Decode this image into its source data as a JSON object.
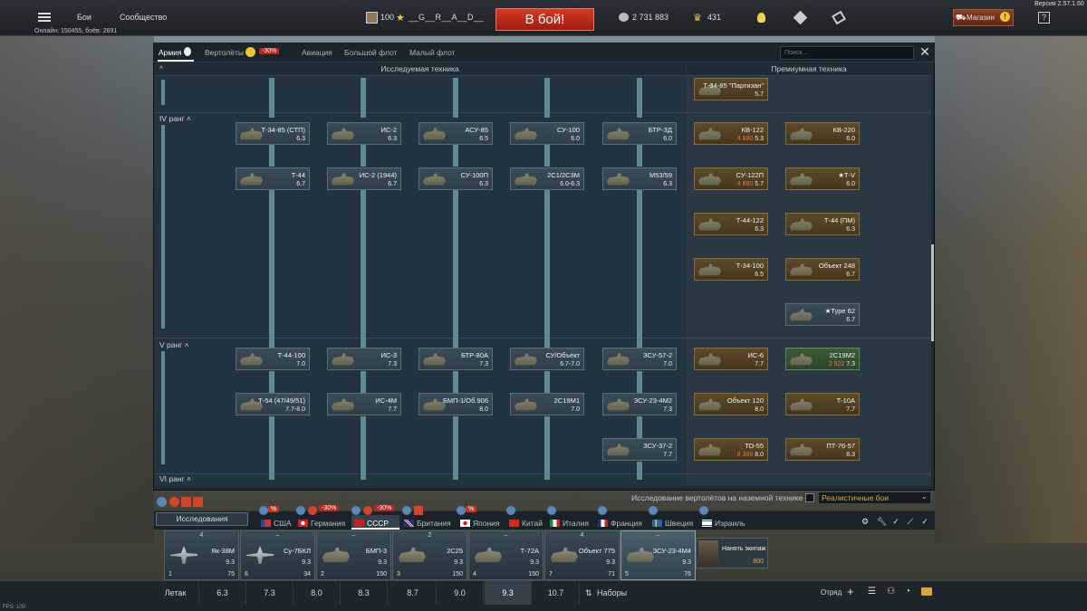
{
  "version": "Версия 2.57.1.60",
  "online": "Онлайн: 150455, боёв: 2691",
  "topnav": {
    "battles": "Бои",
    "community": "Сообщество"
  },
  "player": {
    "level": "100",
    "name": "__G__R__A__D__"
  },
  "battle_button": "В бой!",
  "currency": {
    "silver": "2 731 883",
    "gold": "431"
  },
  "shop": "Магазин",
  "help": "?",
  "tabs": [
    {
      "label": "Армия",
      "active": true
    },
    {
      "label": "Вертолёты"
    },
    {
      "label": "Авиация"
    },
    {
      "label": "Большой флот"
    },
    {
      "label": "Малый флот"
    }
  ],
  "heli_discount": "-30%",
  "search_placeholder": "Поиск...",
  "headers": {
    "researched": "Исследуемая техника",
    "premium": "Премиумная техника"
  },
  "ranks": {
    "r4": "IV ранг ˄",
    "r5": "V ранг ˄",
    "r6": "VI ранг ˄"
  },
  "vehicles": {
    "c1": {
      "name": "Т-34-85 (СТП)",
      "br": "6.3"
    },
    "c2": {
      "name": "Т-44",
      "br": "6.7"
    },
    "c3": {
      "name": "ИС-2",
      "br": "6.3"
    },
    "c4": {
      "name": "ИС-2 (1944)",
      "br": "6.7"
    },
    "c5": {
      "name": "АСУ-85",
      "br": "6.5"
    },
    "c6": {
      "name": "СУ-100П",
      "br": "6.3"
    },
    "c7": {
      "name": "СУ-100",
      "br": "6.0"
    },
    "c8": {
      "name": "2С1/2С3М",
      "br": "6.0-6.3"
    },
    "c9": {
      "name": "БТР-ЗД",
      "br": "6.0"
    },
    "c10": {
      "name": "М53/59",
      "br": "6.3"
    },
    "c11": {
      "name": "Т-44-100",
      "br": "7.0"
    },
    "c12": {
      "name": "Т-54 (47/49/51)",
      "br": "7.7-8.0"
    },
    "c13": {
      "name": "ИС-3",
      "br": "7.3"
    },
    "c14": {
      "name": "ИС-4М",
      "br": "7.7"
    },
    "c15": {
      "name": "БТР-80А",
      "br": "7.3"
    },
    "c16": {
      "name": "БМП-1/Об.906",
      "br": "8.0"
    },
    "c17": {
      "name": "СУ/Объект",
      "br": "6.7-7.0"
    },
    "c18": {
      "name": "2С19М1",
      "br": "7.0"
    },
    "c19": {
      "name": "ЗСУ-57-2",
      "br": "7.0"
    },
    "c20": {
      "name": "ЗСУ-23-4М2",
      "br": "7.3"
    },
    "c21": {
      "name": "ЗСУ-37-2",
      "br": "7.7"
    },
    "p1": {
      "name": "Т-34-85 \"Партизан\"",
      "br": "5.7"
    },
    "p2": {
      "name": "КВ-122",
      "br": "5.3",
      "cost": "4 880"
    },
    "p3": {
      "name": "КВ-220",
      "br": "6.0"
    },
    "p4": {
      "name": "СУ-122П",
      "br": "5.7",
      "cost": "4 880"
    },
    "p5": {
      "name": "★Т-V",
      "br": "6.0"
    },
    "p6": {
      "name": "Т-44-122",
      "br": "6.3"
    },
    "p7": {
      "name": "Т-44 (ПМ)",
      "br": "6.3"
    },
    "p8": {
      "name": "Т-34-100",
      "br": "6.5"
    },
    "p9": {
      "name": "Объект 248",
      "br": "6.7"
    },
    "p10": {
      "name": "★Type 62",
      "br": "6.7"
    },
    "p11": {
      "name": "ИС-6",
      "br": "7.7"
    },
    "p12": {
      "name": "2С19М2",
      "br": "7.3",
      "cost": "2 922"
    },
    "p13": {
      "name": "Объект 120",
      "br": "8.0"
    },
    "p14": {
      "name": "Т-10А",
      "br": "7.7"
    },
    "p15": {
      "name": "ТО-55",
      "br": "8.0",
      "cost": "8 388"
    },
    "p16": {
      "name": "ПТ-76-57",
      "br": "8.3"
    }
  },
  "heli_research": "Исследование вертолётов на наземной технике",
  "mode": "Реалистичные бои",
  "research_btn": "Исследования",
  "nations": [
    {
      "name": "США"
    },
    {
      "name": "Германия"
    },
    {
      "name": "СССР",
      "active": true
    },
    {
      "name": "Британия"
    },
    {
      "name": "Япония"
    },
    {
      "name": "Китай"
    },
    {
      "name": "Италия"
    },
    {
      "name": "Франция"
    },
    {
      "name": "Швеция"
    },
    {
      "name": "Израиль"
    }
  ],
  "nation_badges": {
    "usa": "-30%",
    "ger": "-30%",
    "ussr": "-30%"
  },
  "crew": [
    {
      "name": "Як-38М",
      "br": "9.3",
      "top": "4",
      "slot": "1",
      "cost": "75"
    },
    {
      "name": "Су-7БКЛ",
      "br": "9.3",
      "top": "–",
      "slot": "6",
      "cost": "34"
    },
    {
      "name": "БМП-3",
      "br": "9.3",
      "top": "–",
      "slot": "2",
      "cost": "150"
    },
    {
      "name": "2С25",
      "br": "9.3",
      "top": "2",
      "slot": "3",
      "cost": "150"
    },
    {
      "name": "Т-72А",
      "br": "9.3",
      "top": "–",
      "slot": "4",
      "cost": "150"
    },
    {
      "name": "Объект 775",
      "br": "9.3",
      "top": "4",
      "slot": "7",
      "cost": "71"
    },
    {
      "name": "ЗСУ-23-4М4",
      "br": "9.3",
      "top": "–",
      "slot": "5",
      "cost": "76"
    }
  ],
  "hire": {
    "label": "Нанять экипаж",
    "cost": "800"
  },
  "br_bar": {
    "label": "Летак",
    "values": [
      "6.3",
      "7.3",
      "8.0",
      "8.3",
      "8.7",
      "9.0",
      "9.3",
      "10.7"
    ],
    "selected": "9.3",
    "sets": "Наборы"
  },
  "squad": "Отряд",
  "fps": "FPS: 100"
}
